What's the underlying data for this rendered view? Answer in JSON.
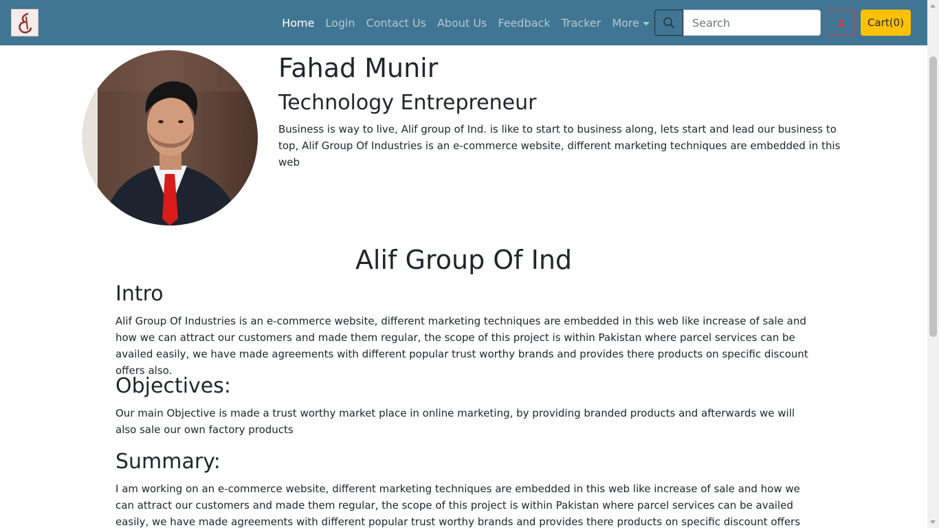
{
  "navbar": {
    "brand_icon": "alif-logo-icon",
    "links": [
      {
        "label": "Home",
        "active": true
      },
      {
        "label": "Login"
      },
      {
        "label": "Contact Us"
      },
      {
        "label": "About Us"
      },
      {
        "label": "Feedback"
      },
      {
        "label": "Tracker"
      },
      {
        "label": "More",
        "dropdown": true
      }
    ],
    "search": {
      "placeholder": "Search",
      "icon": "search-icon"
    },
    "user_icon": "user-icon",
    "cart_label": "Cart(0)"
  },
  "profile": {
    "name": "Fahad Munir",
    "role": "Technology Entrepreneur",
    "bio": "Business is way to live, Alif group of Ind. is like to start to business along, lets start and lead our business to top, Alif Group Of Industries is an e-commerce website, different marketing techniques are embedded in this web"
  },
  "main": {
    "title": "Alif Group Of Ind",
    "sections": [
      {
        "heading": "Intro",
        "text": "Alif Group Of Industries is an e-commerce website, different marketing techniques are embedded in this web like increase of sale and how we can attract our customers and made them regular, the scope of this project is within Pakistan where parcel services can be availed easily, we have made agreements with different popular trust worthy brands and provides there products on specific discount offers also."
      },
      {
        "heading": "Objectives:",
        "text": "Our main Objective is made a trust worthy market place in online marketing, by providing branded products and afterwards we will also sale our own factory products"
      },
      {
        "heading": "Summary:",
        "text": "I am working on an e-commerce website, different marketing techniques are embedded in this web like increase of sale and how we can attract our customers and made them regular, the scope of this project is within Pakistan where parcel services can be availed easily, we have made agreements with different popular trust worthy brands and provides there products on specific discount offers also, soon we will also start our"
      }
    ]
  },
  "colors": {
    "navbar_bg": "#407593",
    "cart_bg": "#ffc107",
    "user_button_border": "#dc3545"
  }
}
